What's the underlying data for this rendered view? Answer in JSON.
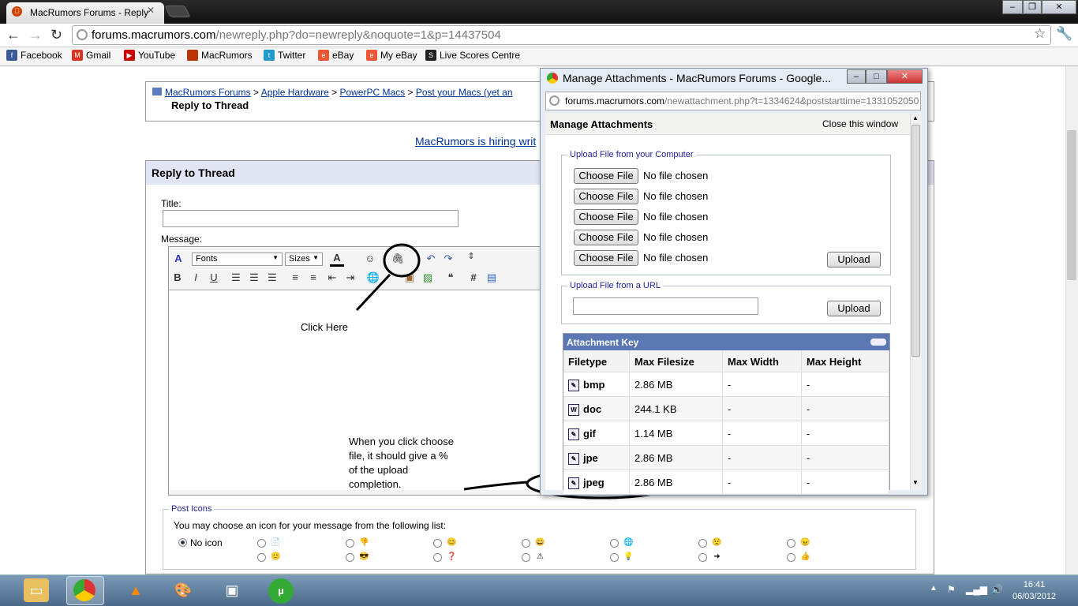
{
  "browser": {
    "tab_title": "MacRumors Forums - Reply",
    "url_host": "forums.macrumors.com",
    "url_path": "/newreply.php?do=newreply&noquote=1&p=14437504",
    "bookmarks": [
      {
        "label": "Facebook",
        "color": "#3b5998"
      },
      {
        "label": "Gmail",
        "color": "#d32"
      },
      {
        "label": "YouTube",
        "color": "#c00"
      },
      {
        "label": "MacRumors",
        "color": "#b30"
      },
      {
        "label": "Twitter",
        "color": "#29c"
      },
      {
        "label": "eBay",
        "color": "#e53"
      },
      {
        "label": "My eBay",
        "color": "#e53"
      },
      {
        "label": "Live Scores Centre",
        "color": "#222"
      }
    ]
  },
  "page": {
    "breadcrumb": [
      "MacRumors Forums",
      "Apple Hardware",
      "PowerPC Macs",
      "Post your Macs (yet an"
    ],
    "current": "Reply to Thread",
    "hiring_link": "MacRumors is hiring writ",
    "reply_header": "Reply to Thread",
    "title_label": "Title:",
    "message_label": "Message:",
    "font_select": "Fonts",
    "size_select": "Sizes",
    "post_icons_legend": "Post Icons",
    "post_icons_text": "You may choose an icon for your message from the following list:",
    "no_icon_label": "No icon"
  },
  "annotations": {
    "click_here": "Click Here",
    "note_lines": [
      "When you click choose",
      "file, it should give a %",
      "of the upload",
      "completion."
    ]
  },
  "popup": {
    "title": "Manage Attachments - MacRumors Forums - Google...",
    "url_host": "forums.macrumors.com",
    "url_path": "/newattachment.php?t=1334624&poststarttime=1331052050",
    "header": "Manage Attachments",
    "close_link": "Close this window",
    "upload_computer_legend": "Upload File from your Computer",
    "choose_file": "Choose File",
    "no_file": "No file chosen",
    "upload_btn": "Upload",
    "upload_url_legend": "Upload File from a URL",
    "attachment_key_title": "Attachment Key",
    "columns": [
      "Filetype",
      "Max Filesize",
      "Max Width",
      "Max Height"
    ],
    "rows": [
      {
        "type": "bmp",
        "size": "2.86 MB",
        "width": "-",
        "height": "-"
      },
      {
        "type": "doc",
        "size": "244.1 KB",
        "width": "-",
        "height": "-"
      },
      {
        "type": "gif",
        "size": "1.14 MB",
        "width": "-",
        "height": "-"
      },
      {
        "type": "jpe",
        "size": "2.86 MB",
        "width": "-",
        "height": "-"
      },
      {
        "type": "jpeg",
        "size": "2.86 MB",
        "width": "-",
        "height": "-"
      }
    ]
  },
  "taskbar": {
    "time": "16:41",
    "date": "06/03/2012"
  }
}
